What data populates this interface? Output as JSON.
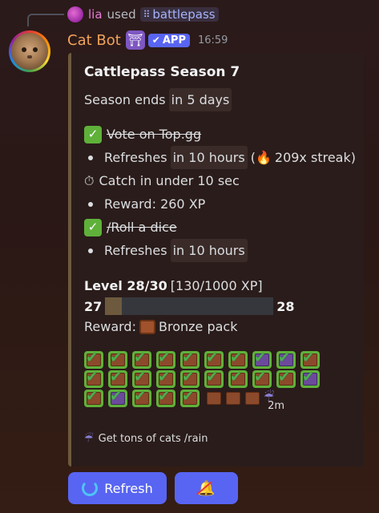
{
  "reply": {
    "user": "lia",
    "used_text": "used",
    "command": "battlepass"
  },
  "message": {
    "author": "Cat Bot",
    "app_badge": "APP",
    "timestamp": "16:59"
  },
  "embed": {
    "title": "Cattlepass Season 7",
    "season_label": "Season ends",
    "season_value": "in 5 days",
    "quests": [
      {
        "title": "Vote on Top.gg",
        "refresh_label": "Refreshes",
        "refresh_value": "in 10 hours",
        "streak_text": "209x streak)"
      },
      {
        "title": "Catch in under 10 sec",
        "reward": "Reward: 260 XP"
      },
      {
        "title": "/Roll a dice",
        "refresh_label": "Refreshes",
        "refresh_value": "in 10 hours"
      }
    ],
    "level": {
      "label": "Level 28/30",
      "xp": "[130/1000 XP]",
      "current": "27",
      "next": "28",
      "progress": 0.13,
      "reward_label": "Reward:",
      "reward_value": "Bronze pack"
    },
    "timer_label": "2m",
    "footer": "Get tons of cats /rain"
  },
  "buttons": {
    "refresh": "Refresh"
  },
  "colors": {
    "accent": "#5865f2",
    "embed_border": "#6d5a3e",
    "author": "#f0a35b",
    "reply_user": "#e67bd6"
  }
}
